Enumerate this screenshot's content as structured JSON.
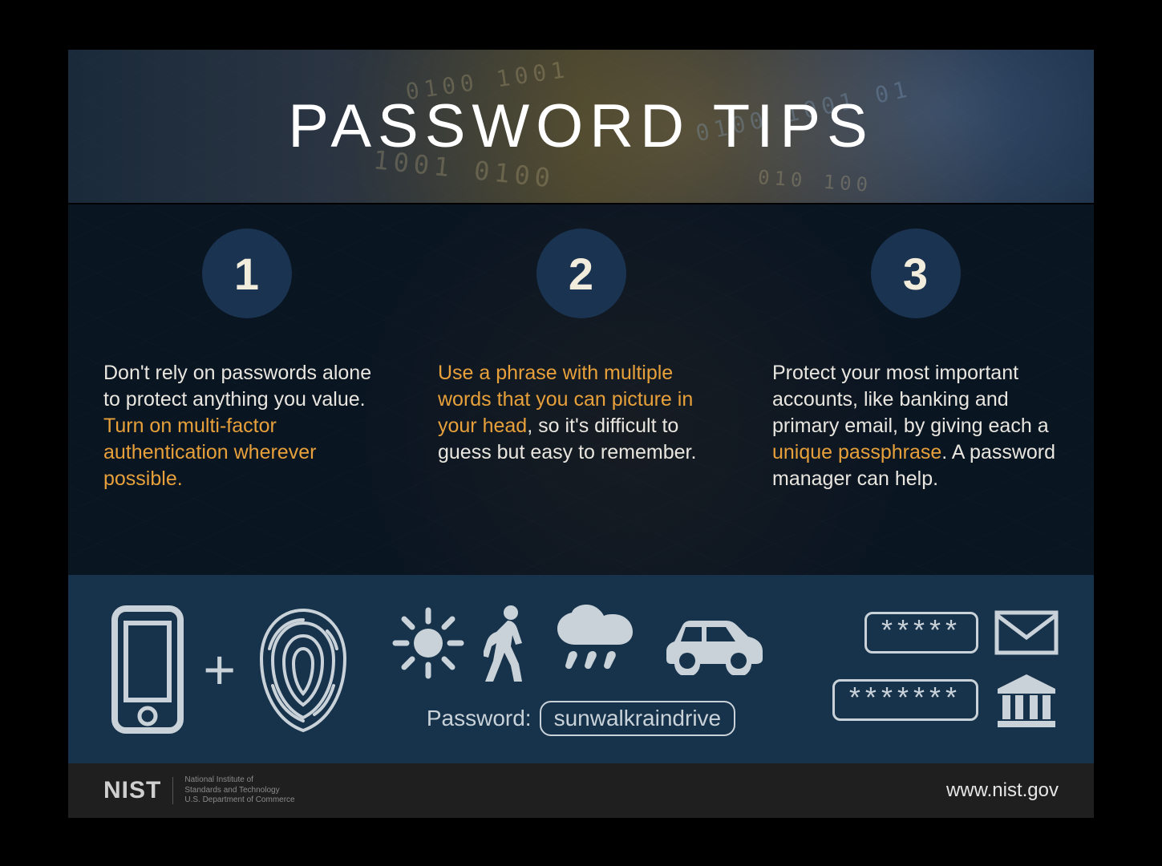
{
  "title": "PASSWORD TIPS",
  "tips": [
    {
      "num": "1",
      "plain1": "Don't rely on passwords alone to protect anything you value. ",
      "highlight": "Turn on multi-factor authentication wherever possible.",
      "plain2": ""
    },
    {
      "num": "2",
      "plain1": "",
      "highlight": "Use a phrase with multiple words that you can picture in your head",
      "plain2": ", so it's difficult to guess but easy to remember."
    },
    {
      "num": "3",
      "plain1": "Protect your most important accounts, like banking and primary email, by giving each a ",
      "highlight": "unique passphrase",
      "plain2": ". A password manager can help."
    }
  ],
  "example": {
    "label": "Password:",
    "value": "sunwalkraindrive"
  },
  "masks": {
    "row1": "*****",
    "row2": "*******"
  },
  "footer": {
    "logo": "NIST",
    "org_line1": "National Institute of",
    "org_line2": "Standards and Technology",
    "org_line3": "U.S. Department of Commerce",
    "url": "www.nist.gov"
  }
}
